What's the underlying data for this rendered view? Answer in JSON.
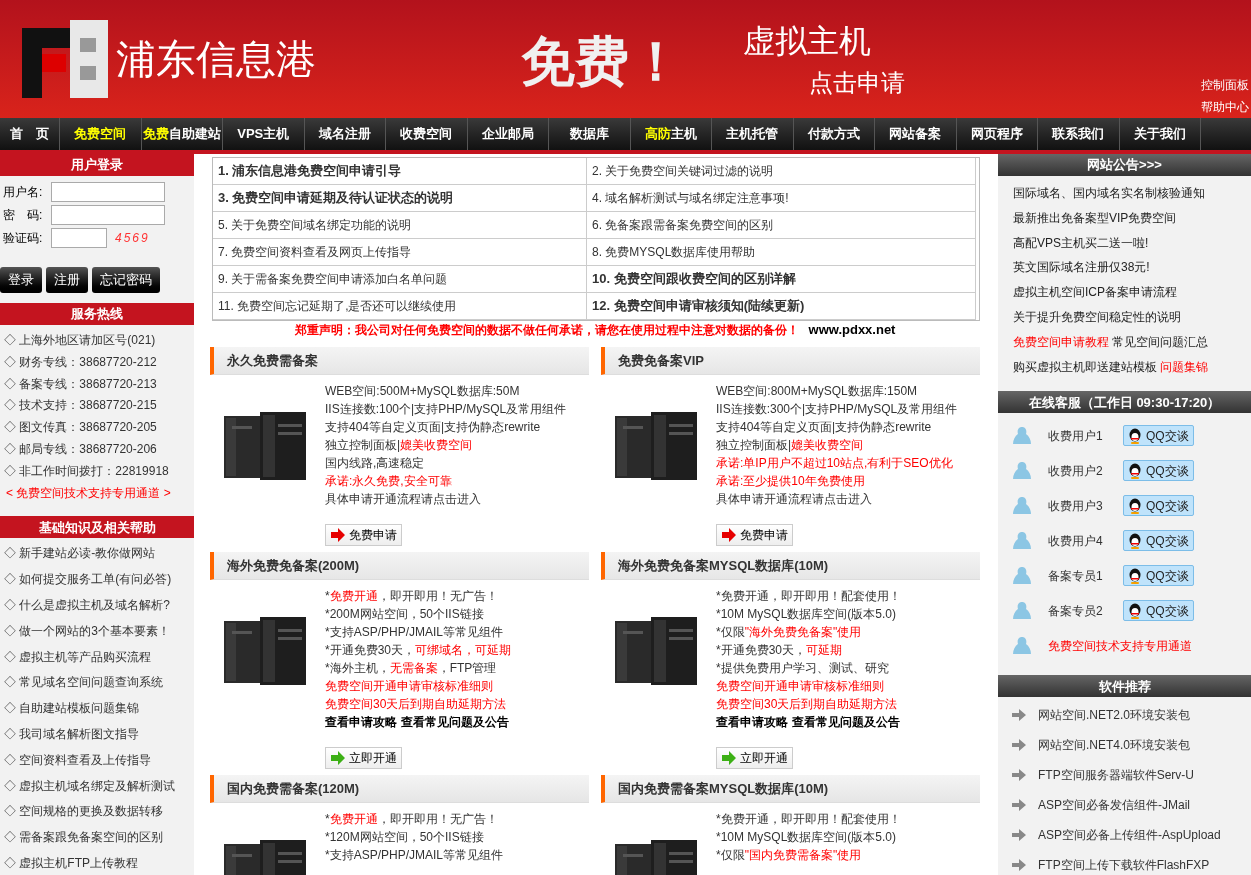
{
  "header": {
    "logo_text": "浦东信息港",
    "banner": {
      "headline": "免费！",
      "product": "虚拟主机",
      "cta": "点击申请"
    },
    "links": [
      "控制面板",
      "帮助中心"
    ]
  },
  "nav": [
    {
      "parts": [
        {
          "text": "首　页",
          "highlight": false
        }
      ]
    },
    {
      "parts": [
        {
          "text": "免费空间",
          "highlight": true
        }
      ]
    },
    {
      "parts": [
        {
          "text": "免费",
          "highlight": true
        },
        {
          "text": "自助建站",
          "highlight": false
        }
      ]
    },
    {
      "parts": [
        {
          "text": "VPS主机",
          "highlight": false
        }
      ]
    },
    {
      "parts": [
        {
          "text": "域名注册",
          "highlight": false
        }
      ]
    },
    {
      "parts": [
        {
          "text": "收费空间",
          "highlight": false
        }
      ]
    },
    {
      "parts": [
        {
          "text": "企业邮局",
          "highlight": false
        }
      ]
    },
    {
      "parts": [
        {
          "text": "数据库",
          "highlight": false
        }
      ]
    },
    {
      "parts": [
        {
          "text": "高防",
          "highlight": true
        },
        {
          "text": "主机",
          "highlight": false
        }
      ]
    },
    {
      "parts": [
        {
          "text": "主机托管",
          "highlight": false
        }
      ]
    },
    {
      "parts": [
        {
          "text": "付款方式",
          "highlight": false
        }
      ]
    },
    {
      "parts": [
        {
          "text": "网站备案",
          "highlight": false
        }
      ]
    },
    {
      "parts": [
        {
          "text": "网页程序",
          "highlight": false
        }
      ]
    },
    {
      "parts": [
        {
          "text": "联系我们",
          "highlight": false
        }
      ]
    },
    {
      "parts": [
        {
          "text": "关于我们",
          "highlight": false
        }
      ]
    }
  ],
  "login": {
    "title": "用户登录",
    "fields": [
      {
        "label": "用户名:",
        "kind": "wide"
      },
      {
        "label": "密　码:",
        "kind": "wide"
      },
      {
        "label": "验证码:",
        "kind": "captcha"
      }
    ],
    "captcha": "4569",
    "buttons": [
      "登录",
      "注册",
      "忘记密码"
    ]
  },
  "hotline": {
    "title": "服务热线",
    "items": [
      "◇ 上海外地区请加区号(021)",
      "◇ 财务专线：38687720-212",
      "◇ 备案专线：38687720-213",
      "◇ 技术支持：38687720-215",
      "◇ 图文传真：38687720-205",
      "◇ 邮局专线：38687720-206",
      "◇ 非工作时间拨打：22819918"
    ],
    "link": "< 免费空间技术支持专用通道 >"
  },
  "help": {
    "title": "基础知识及相关帮助",
    "items": [
      "◇ 新手建站必读-教你做网站",
      "◇ 如何提交服务工单(有问必答)",
      "◇ 什么是虚拟主机及域名解析?",
      "◇ 做一个网站的3个基本要素！",
      "◇ 虚拟主机等产品购买流程",
      "◇ 常见域名空间问题查询系统",
      "◇ 自助建站模板问题集锦",
      "◇ 我司域名解析图文指导",
      "◇ 空间资料查看及上传指导",
      "◇ 虚拟主机域名绑定及解析测试",
      "◇ 空间规格的更换及数据转移",
      "◇ 需备案跟免备案空间的区别",
      "◇ 虚拟主机FTP上传教程"
    ]
  },
  "guide_table": [
    {
      "text": "1. 浦东信息港免费空间申请引导",
      "bold": true
    },
    {
      "text": "2. 关于免费空间关键词过滤的说明",
      "bold": false
    },
    {
      "text": "3. 免费空间申请延期及待认证状态的说明",
      "bold": true
    },
    {
      "text": "4. 域名解析测试与域名绑定注意事项!",
      "bold": false
    },
    {
      "text": "5. 关于免费空间域名绑定功能的说明",
      "bold": false
    },
    {
      "text": "6. 免备案跟需备案免费空间的区别",
      "bold": false
    },
    {
      "text": "7. 免费空间资料查看及网页上传指导",
      "bold": false
    },
    {
      "text": "8. 免费MYSQL数据库使用帮助",
      "bold": false
    },
    {
      "text": "9. 关于需备案免费空间申请添加白名单问题",
      "bold": false
    },
    {
      "text": "10. 免费空间跟收费空间的区别详解",
      "bold": true
    },
    {
      "text": "11. 免费空间忘记延期了,是否还可以继续使用",
      "bold": false
    },
    {
      "text": "12. 免费空间申请审核须知(陆续更新)",
      "bold": true
    }
  ],
  "disclaimer": {
    "text": "郑重声明：我公司对任何免费空间的数据不做任何承诺，请您在使用过程中注意对数据的备份！",
    "site": "www.pdxx.net"
  },
  "plans": [
    {
      "title": "永久免费需备案",
      "lines": [
        [
          {
            "text": "WEB空间:500M+MySQL数据库:50M",
            "red": false
          }
        ],
        [
          {
            "text": "IIS连接数:100个|支持PHP/MySQL及常用组件",
            "red": false
          }
        ],
        [
          {
            "text": "支持404等自定义页面|支持伪静态rewrite",
            "red": false
          }
        ],
        [
          {
            "text": "独立控制面板|",
            "red": false
          },
          {
            "text": "媲美收费空间",
            "red": true
          }
        ],
        [
          {
            "text": "国内线路,高速稳定",
            "red": false
          }
        ],
        [
          {
            "text": "承诺:永久免费,安全可靠",
            "red": true
          }
        ],
        [
          {
            "text": "具体申请开通流程请点击进入",
            "red": false
          }
        ]
      ],
      "button": {
        "label": "免费申请",
        "kind": "apply"
      }
    },
    {
      "title": "免费免备案VIP",
      "lines": [
        [
          {
            "text": "WEB空间:800M+MySQL数据库:150M",
            "red": false
          }
        ],
        [
          {
            "text": "IIS连接数:300个|支持PHP/MySQL及常用组件",
            "red": false
          }
        ],
        [
          {
            "text": "支持404等自定义页面|支持伪静态rewrite",
            "red": false
          }
        ],
        [
          {
            "text": "独立控制面板|",
            "red": false
          },
          {
            "text": "媲美收费空间",
            "red": true
          }
        ],
        [
          {
            "text": "承诺:单IP用户不超过10站点,有利于SEO优化",
            "red": true
          }
        ],
        [
          {
            "text": "承诺:至少提供10年免费使用",
            "red": true
          }
        ],
        [
          {
            "text": "具体申请开通流程请点击进入",
            "red": false
          }
        ]
      ],
      "button": {
        "label": "免费申请",
        "kind": "apply"
      }
    },
    {
      "title": "海外免费免备案(200M)",
      "lines": [
        [
          {
            "text": "*",
            "red": false
          },
          {
            "text": "免费开通",
            "red": true
          },
          {
            "text": "，即开即用！无广告！",
            "red": false
          }
        ],
        [
          {
            "text": "*200M网站空间，50个IIS链接",
            "red": false
          }
        ],
        [
          {
            "text": "*支持ASP/PHP/JMAIL等常见组件",
            "red": false
          }
        ],
        [
          {
            "text": "*开通免费30天，",
            "red": false
          },
          {
            "text": "可绑域名，可延期",
            "red": true
          }
        ],
        [
          {
            "text": "*海外主机，",
            "red": false
          },
          {
            "text": "无需备案",
            "red": true
          },
          {
            "text": "，FTP管理",
            "red": false
          }
        ],
        [
          {
            "text": "免费空间开通申请审核标准细则",
            "red": true
          }
        ],
        [
          {
            "text": "免费空间30天后到期自助延期方法",
            "red": true
          }
        ]
      ],
      "links": [
        "查看申请攻略",
        "查看常见问题及公告"
      ],
      "button": {
        "label": "立即开通",
        "kind": "open"
      }
    },
    {
      "title": "海外免费免备案MYSQL数据库(10M)",
      "lines": [
        [
          {
            "text": "*免费开通，即开即用！配套使用！",
            "red": false
          }
        ],
        [
          {
            "text": "*10M MySQL数据库空间(版本5.0)",
            "red": false
          }
        ],
        [
          {
            "text": "*仅限",
            "red": false
          },
          {
            "text": "\"海外免费免备案\"使用",
            "red": true
          }
        ],
        [
          {
            "text": "*开通免费30天，",
            "red": false
          },
          {
            "text": "可延期",
            "red": true
          }
        ],
        [
          {
            "text": "*提供免费用户学习、测试、研究",
            "red": false
          }
        ],
        [
          {
            "text": "免费空间开通申请审核标准细则",
            "red": true
          }
        ],
        [
          {
            "text": "免费空间30天后到期自助延期方法",
            "red": true
          }
        ]
      ],
      "links": [
        "查看申请攻略",
        "查看常见问题及公告"
      ],
      "button": {
        "label": "立即开通",
        "kind": "open"
      }
    },
    {
      "title": "国内免费需备案(120M)",
      "lines": [
        [
          {
            "text": "*",
            "red": false
          },
          {
            "text": "免费开通",
            "red": true
          },
          {
            "text": "，即开即用！无广告！",
            "red": false
          }
        ],
        [
          {
            "text": "*120M网站空间，50个IIS链接",
            "red": false
          }
        ],
        [
          {
            "text": "*支持ASP/PHP/JMAIL等常见组件",
            "red": false
          }
        ]
      ]
    },
    {
      "title": "国内免费需备案MYSQL数据库(10M)",
      "lines": [
        [
          {
            "text": "*免费开通，即开即用！配套使用！",
            "red": false
          }
        ],
        [
          {
            "text": "*10M MySQL数据库空间(版本5.0)",
            "red": false
          }
        ],
        [
          {
            "text": "*仅限",
            "red": false
          },
          {
            "text": "\"国内免费需备案\"使用",
            "red": true
          }
        ]
      ]
    }
  ],
  "notices": {
    "title": "网站公告>>>",
    "items": [
      [
        {
          "text": "国际域名、国内域名实名制核验通知",
          "red": false
        }
      ],
      [
        {
          "text": "最新推出免备案型VIP免费空间",
          "red": false
        }
      ],
      [
        {
          "text": "高配VPS主机买二送一啦!",
          "red": false
        }
      ],
      [
        {
          "text": "英文国际域名注册仅38元!",
          "red": false
        }
      ],
      [
        {
          "text": "虚拟主机空间ICP备案申请流程",
          "red": false
        }
      ],
      [
        {
          "text": "关于提升免费空间稳定性的说明",
          "red": false
        }
      ],
      [
        {
          "text": "免费空间申请教程",
          "red": true
        },
        {
          "text": " 常见空间问题汇总",
          "red": false
        }
      ],
      [
        {
          "text": "购买虚拟主机即送建站模板 ",
          "red": false
        },
        {
          "text": "问题集锦",
          "red": true
        }
      ]
    ]
  },
  "support": {
    "title": "在线客服（工作日 09:30-17:20）",
    "agents": [
      {
        "name": "收费用户1",
        "button": "QQ交谈"
      },
      {
        "name": "收费用户2",
        "button": "QQ交谈"
      },
      {
        "name": "收费用户3",
        "button": "QQ交谈"
      },
      {
        "name": "收费用户4",
        "button": "QQ交谈"
      },
      {
        "name": "备案专员1",
        "button": "QQ交谈"
      },
      {
        "name": "备案专员2",
        "button": "QQ交谈"
      }
    ],
    "link": "免费空间技术支持专用通道"
  },
  "software": {
    "title": "软件推荐",
    "items": [
      "网站空间.NET2.0环境安装包",
      "网站空间.NET4.0环境安装包",
      "FTP空间服务器端软件Serv-U",
      "ASP空间必备发信组件-JMail",
      "ASP空间必备上传组件-AspUpload",
      "FTP空间上传下载软件FlashFXP"
    ]
  }
}
